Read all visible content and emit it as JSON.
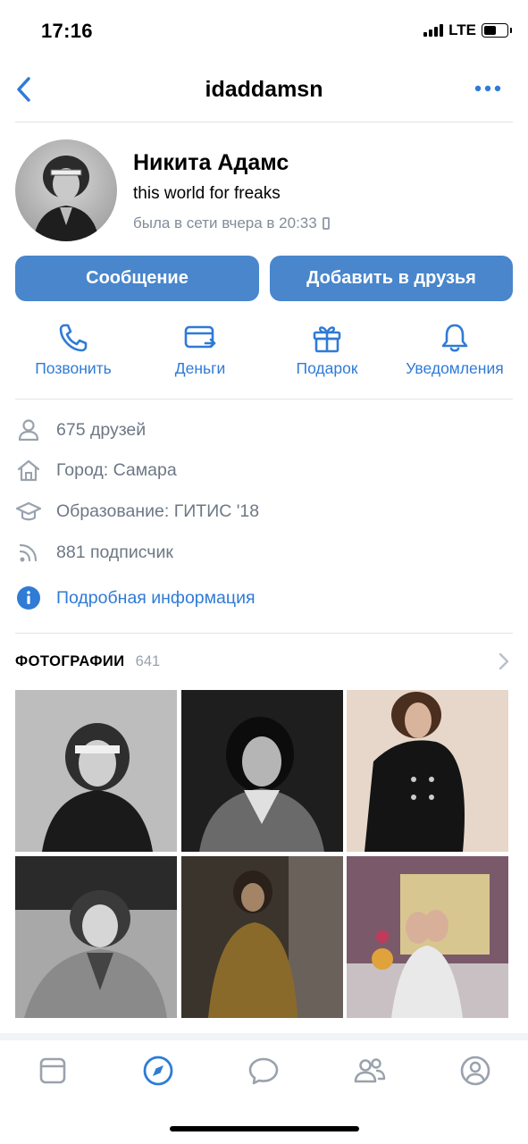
{
  "status_bar": {
    "time": "17:16",
    "network": "LTE"
  },
  "nav": {
    "title": "idaddamsn"
  },
  "profile": {
    "name": "Никита Адамс",
    "status": "this world for freaks",
    "online": "была в сети вчера в 20:33"
  },
  "buttons": {
    "message": "Сообщение",
    "add_friend": "Добавить в друзья"
  },
  "actions": [
    {
      "label": "Позвонить",
      "icon": "phone-icon"
    },
    {
      "label": "Деньги",
      "icon": "money-card-icon"
    },
    {
      "label": "Подарок",
      "icon": "gift-icon"
    },
    {
      "label": "Уведомления",
      "icon": "bell-icon"
    }
  ],
  "info": {
    "friends": "675 друзей",
    "city": "Город: Самара",
    "education": "Образование: ГИТИС '18",
    "followers": "881 подписчик",
    "more": "Подробная информация"
  },
  "photos": {
    "title": "ФОТОГРАФИИ",
    "count": "641"
  },
  "tabbar": [
    {
      "name": "news",
      "icon": "newsfeed-icon"
    },
    {
      "name": "discover",
      "icon": "compass-icon",
      "active": true
    },
    {
      "name": "messages",
      "icon": "message-bubble-icon"
    },
    {
      "name": "friends",
      "icon": "friends-icon"
    },
    {
      "name": "profile",
      "icon": "profile-icon"
    }
  ],
  "colors": {
    "accent": "#2f7bd6",
    "button": "#4986cc",
    "secondary_text": "#6d7885"
  }
}
